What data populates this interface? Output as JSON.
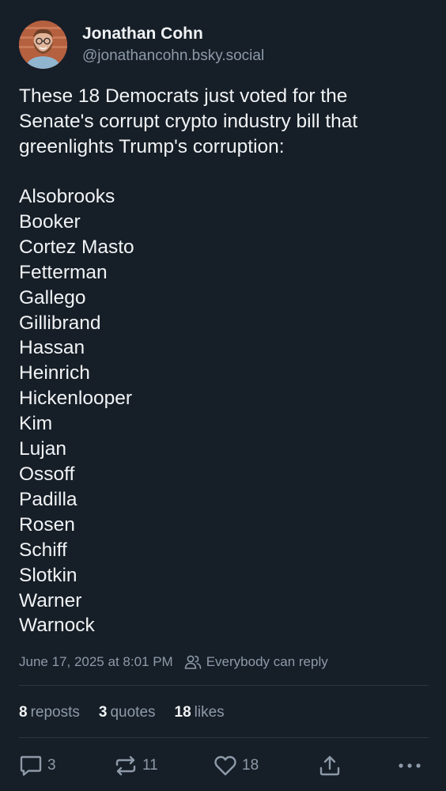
{
  "author": {
    "display_name": "Jonathan Cohn",
    "handle": "@jonathancohn.bsky.social"
  },
  "post": {
    "intro": "These 18 Democrats just voted for the Senate's corrupt crypto industry bill that greenlights Trump's corruption:",
    "names": [
      "Alsobrooks",
      "Booker",
      "Cortez Masto",
      "Fetterman",
      "Gallego",
      "Gillibrand",
      "Hassan",
      "Heinrich",
      "Hickenlooper",
      "Kim",
      "Lujan",
      "Ossoff",
      "Padilla",
      "Rosen",
      "Schiff",
      "Slotkin",
      "Warner",
      "Warnock"
    ],
    "timestamp": "June 17, 2025 at 8:01 PM",
    "reply_setting": "Everybody can reply"
  },
  "stats": {
    "reposts_count": "8",
    "reposts_label": "reposts",
    "quotes_count": "3",
    "quotes_label": "quotes",
    "likes_count": "18",
    "likes_label": "likes"
  },
  "actions": {
    "reply_count": "3",
    "repost_count": "11",
    "like_count": "18"
  },
  "icons": {
    "reply": "speech-bubble-icon",
    "repost": "repost-arrows-icon",
    "like": "heart-icon",
    "share": "share-upload-icon",
    "more": "ellipsis-icon",
    "reply_setting": "people-icon"
  },
  "colors": {
    "background": "#161e27",
    "text": "#f1f3f5",
    "muted": "#8d9aa9",
    "divider": "#2a3542"
  }
}
